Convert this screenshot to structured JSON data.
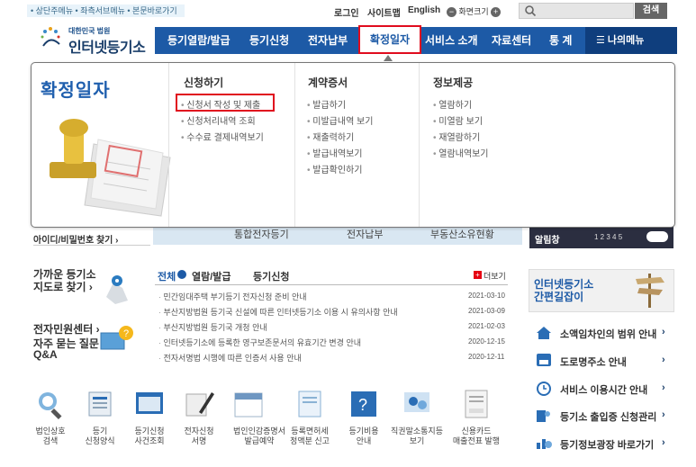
{
  "top": {
    "skip_links": "• 상단주메뉴 • 좌측서브메뉴 • 본문바로가기",
    "login": "로그인",
    "sitemap": "사이트맵",
    "english": "English",
    "zoom_label": "화면크기",
    "search_btn": "검색"
  },
  "logo": {
    "sub": "대한민국 법원",
    "title": "인터넷등기소"
  },
  "nav": {
    "items": [
      "등기열람/발급",
      "등기신청",
      "전자납부",
      "확정일자",
      "서비스 소개",
      "자료센터",
      "통 계"
    ],
    "my_menu": "나의메뉴"
  },
  "panel": {
    "title": "확정일자",
    "columns": [
      {
        "title": "신청하기",
        "items": [
          "신청서 작성 및 제출",
          "신청처리내역 조회",
          "수수료 결제내역보기"
        ]
      },
      {
        "title": "계약증서",
        "items": [
          "발급하기",
          "미발급내역 보기",
          "재출력하기",
          "발급내역보기",
          "발급확인하기"
        ]
      },
      {
        "title": "정보제공",
        "items": [
          "열람하기",
          "미열람 보기",
          "재열람하기",
          "열람내역보기"
        ]
      }
    ]
  },
  "strip": {
    "idpw": "아이디/비밀번호 찾기 ›",
    "items": [
      "통합전자등기",
      "전자납부",
      "부동산소유현황"
    ],
    "alarm_label": "알림창",
    "pages": "1 2 3 4 5"
  },
  "left": {
    "nearby": "가까운 등기소\n지도로 찾기 ›",
    "civil": "전자민원센터 ›",
    "faq": "자주 묻는 질문\nQ&A"
  },
  "notices": {
    "tabs": [
      "전체",
      "열람/발급",
      "등기신청"
    ],
    "more": "더보기",
    "items": [
      {
        "text": "민간임대주택 부기등기 전자신청 준비 안내",
        "date": "2021-03-10"
      },
      {
        "text": "부산지방법원 등기국 신설에 따른 인터넷등기소 이용 시 유의사항 안내",
        "date": "2021-03-09"
      },
      {
        "text": "부산지방법원 등기국 개청 안내",
        "date": "2021-02-03"
      },
      {
        "text": "인터넷등기소에 등록한 영구보존문서의 유효기간 변경 안내",
        "date": "2020-12-15"
      },
      {
        "text": "전자서명법 시행에 따른 인증서 사용 안내",
        "date": "2020-12-11"
      }
    ]
  },
  "right": {
    "guide": "인터넷등기소\n간편길잡이",
    "links": [
      "소액임차인의 범위 안내",
      "도로명주소 안내",
      "서비스 이용시간 안내",
      "등기소 출입증 신청관리",
      "등기정보광장 바로가기"
    ]
  },
  "bottom": {
    "items": [
      "법인상호\n검색",
      "등기\n신청양식",
      "등기신청\n사건조회",
      "전자신청\n서명",
      "법인인감증명서\n발급예약",
      "등록면허세\n정액분 신고",
      "등기비용\n안내",
      "직권말소통지등\n보기",
      "신용카드\n매출전표 발행"
    ]
  },
  "colors": {
    "nav": "#1d5aa6",
    "highlight": "#e00c1e",
    "accent": "#1f5fae"
  }
}
